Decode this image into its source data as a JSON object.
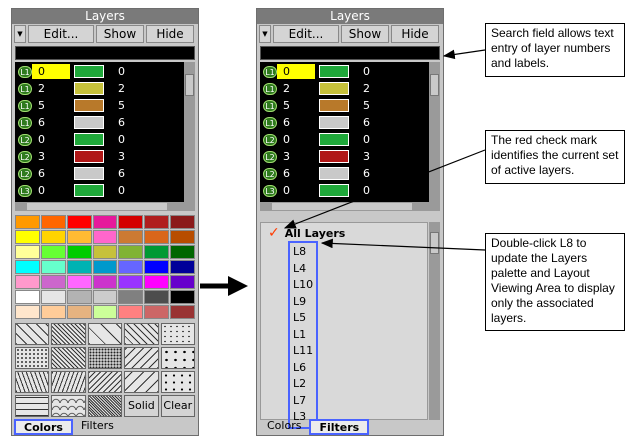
{
  "left_panel": {
    "title": "Layers",
    "toolbar": {
      "menu_glyph": "▼",
      "edit_label": "Edit...",
      "show_label": "Show",
      "hide_label": "Hide"
    },
    "layers": [
      {
        "badge": "L1",
        "num": "0",
        "value": "0",
        "swatch": "#1fa83a",
        "selected": true
      },
      {
        "badge": "L1",
        "num": "2",
        "value": "2",
        "swatch": "#c6c13b"
      },
      {
        "badge": "L1",
        "num": "5",
        "value": "5",
        "swatch": "#b8792a"
      },
      {
        "badge": "L1",
        "num": "6",
        "value": "6",
        "swatch": "#c9c9c9"
      },
      {
        "badge": "L2",
        "num": "0",
        "value": "0",
        "swatch": "#1fa83a"
      },
      {
        "badge": "L2",
        "num": "3",
        "value": "3",
        "swatch": "#b01717"
      },
      {
        "badge": "L2",
        "num": "6",
        "value": "6",
        "swatch": "#c9c9c9"
      },
      {
        "badge": "L3",
        "num": "0",
        "value": "0",
        "swatch": "#1fa83a"
      }
    ],
    "palette": [
      "#ff9900",
      "#ff6600",
      "#ff0000",
      "#e6199b",
      "#d40000",
      "#b01e1e",
      "#8b1a1a",
      "#ffff00",
      "#ffd400",
      "#ffbb33",
      "#ff66cc",
      "#cc7a33",
      "#d9661a",
      "#b84d00",
      "#ffff99",
      "#66ff33",
      "#00cc00",
      "#c6c13b",
      "#80b333",
      "#009933",
      "#006600",
      "#00ffff",
      "#66ffcc",
      "#00b3b3",
      "#0099cc",
      "#6666ff",
      "#0000ff",
      "#000099",
      "#ff99cc",
      "#cc66cc",
      "#ff66ff",
      "#cc33cc",
      "#9933ff",
      "#ff00ff",
      "#6600cc",
      "#ffffff",
      "#e6e6e6",
      "#b3b3b3",
      "#cccccc",
      "#808080",
      "#4d4d4d",
      "#000000",
      "#ffe6cc",
      "#ffcc99",
      "#e6b380",
      "#ccff99",
      "#ff8080",
      "#cc6666",
      "#993333"
    ],
    "patterns": [
      "diagonal",
      "diagonal-dense",
      "diagonal-wide",
      "diagonal-fine",
      "wave",
      "dots",
      "crosshatch",
      "dots-dense",
      "diagonal-back",
      "triangles",
      "zigzag",
      "zigzag-dense",
      "diagonal-back-dense",
      "diagonal-back-wide",
      "plus",
      "brick",
      "curves",
      "crosshatch-dense",
      "solid",
      "clear"
    ],
    "solid_label": "Solid",
    "clear_label": "Clear",
    "tabs": {
      "colors": "Colors",
      "filters": "Filters"
    }
  },
  "right_panel": {
    "title": "Layers",
    "toolbar": {
      "menu_glyph": "▼",
      "edit_label": "Edit...",
      "show_label": "Show",
      "hide_label": "Hide"
    },
    "layers": [
      {
        "badge": "L1",
        "num": "0",
        "value": "0",
        "swatch": "#1fa83a",
        "selected": true
      },
      {
        "badge": "L1",
        "num": "2",
        "value": "2",
        "swatch": "#c6c13b"
      },
      {
        "badge": "L1",
        "num": "5",
        "value": "5",
        "swatch": "#b8792a"
      },
      {
        "badge": "L1",
        "num": "6",
        "value": "6",
        "swatch": "#c9c9c9"
      },
      {
        "badge": "L2",
        "num": "0",
        "value": "0",
        "swatch": "#1fa83a"
      },
      {
        "badge": "L2",
        "num": "3",
        "value": "3",
        "swatch": "#b01717"
      },
      {
        "badge": "L2",
        "num": "6",
        "value": "6",
        "swatch": "#c9c9c9"
      },
      {
        "badge": "L3",
        "num": "0",
        "value": "0",
        "swatch": "#1fa83a"
      }
    ],
    "filters": {
      "check_glyph": "✓",
      "all_label": "All Layers",
      "items": [
        "L8",
        "L4",
        "L10",
        "L9",
        "L5",
        "L1",
        "L11",
        "L6",
        "L2",
        "L7",
        "L3"
      ]
    },
    "tabs": {
      "colors": "Colors",
      "filters": "Filters"
    }
  },
  "callouts": {
    "search": "Search field allows text entry of layer numbers and labels.",
    "check": "The red check mark identifies the current set of active layers.",
    "double_click": "Double-click L8 to update the Layers palette and Layout Viewing Area to display only the associated layers."
  },
  "colors": {
    "active_tab_outline": "#4a63ff",
    "check_mark": "#ff3b00",
    "selection": "#ffff00"
  }
}
